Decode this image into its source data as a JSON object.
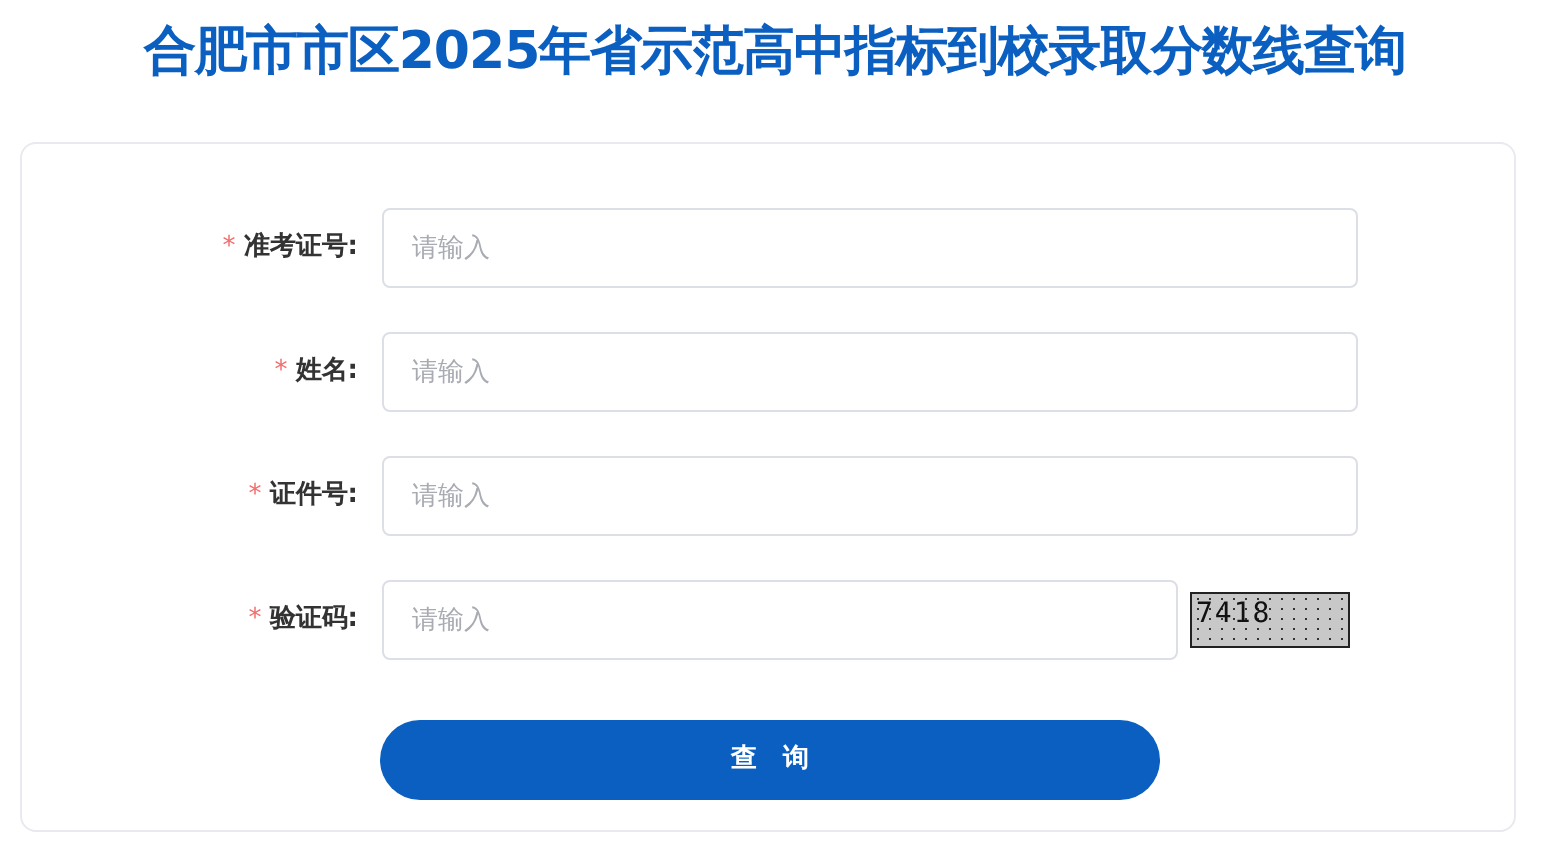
{
  "title": "合肥市市区2025年省示范高中指标到校录取分数线查询",
  "fields": [
    {
      "mark": "*",
      "label": "准考证号:",
      "placeholder": "请输入",
      "kind": "text"
    },
    {
      "mark": "*",
      "label": "姓名:",
      "placeholder": "请输入",
      "kind": "text"
    },
    {
      "mark": "*",
      "label": "证件号:",
      "placeholder": "请输入",
      "kind": "text"
    },
    {
      "mark": "*",
      "label": "验证码:",
      "placeholder": "请输入",
      "kind": "captcha",
      "captcha": "7418"
    }
  ],
  "submit": "查　询"
}
